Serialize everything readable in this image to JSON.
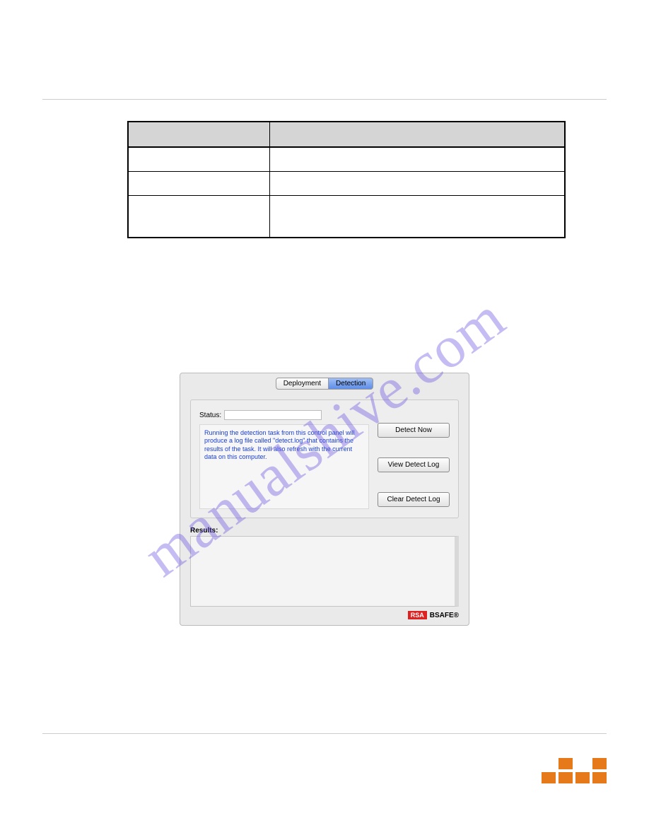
{
  "watermark": "manualshive.com",
  "table": {
    "headers": [
      "",
      ""
    ],
    "rows": [
      [
        "",
        ""
      ],
      [
        "",
        ""
      ],
      [
        "",
        ""
      ]
    ]
  },
  "dialog": {
    "tabs": {
      "deployment": "Deployment",
      "detection": "Detection"
    },
    "status_label": "Status:",
    "status_value": "",
    "info_text": "Running the detection task from this control panel will produce a log file called \"detect.log\" that contains the results of the task. It will also refresh with the current data on this computer.",
    "buttons": {
      "detect_now": "Detect Now",
      "view_log": "View Detect Log",
      "clear_log": "Clear Detect Log"
    },
    "results_label": "Results:",
    "results_value": "",
    "logo": {
      "rsa": "RSA",
      "bsafe": "BSAFE",
      "reg": "®"
    }
  }
}
